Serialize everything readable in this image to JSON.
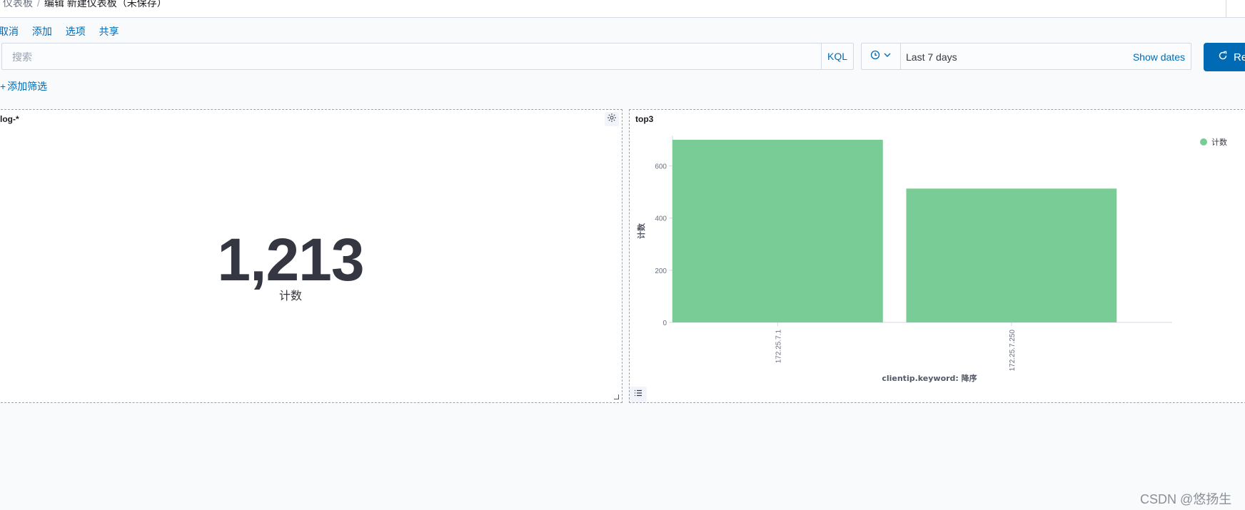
{
  "breadcrumb": {
    "parent": "仪表板",
    "current": "编辑 新建仪表板（未保存）"
  },
  "menu": {
    "cancel": "取消",
    "add": "添加",
    "options": "选项",
    "share": "共享"
  },
  "search": {
    "placeholder": "搜索",
    "language": "KQL"
  },
  "datepicker": {
    "range": "Last 7 days",
    "show_dates": "Show dates"
  },
  "refresh": {
    "label": "Re"
  },
  "filter": {
    "add_label": "添加筛选"
  },
  "panels": [
    {
      "title": "log-*",
      "metric_value": "1,213",
      "metric_label": "计数"
    },
    {
      "title": "top3"
    }
  ],
  "icons": {
    "gear": "gear-icon",
    "clock": "clock-icon",
    "chevron": "chevron-down-icon",
    "refresh": "refresh-icon",
    "legend": "list-icon"
  },
  "colors": {
    "accent": "#006bb4",
    "bar": "#7acc96"
  },
  "chart_data": {
    "type": "bar",
    "categories": [
      "172.25.7.1",
      "172.25.7.250"
    ],
    "values": [
      700,
      513
    ],
    "xlabel": "clientip.keyword: 降序",
    "ylabel": "计数",
    "yticks": [
      0,
      200,
      400,
      600
    ],
    "ylim": [
      0,
      700
    ],
    "legend": [
      "计数"
    ],
    "legend_position": "top-right",
    "grid": false
  },
  "watermark": "CSDN @悠扬生"
}
